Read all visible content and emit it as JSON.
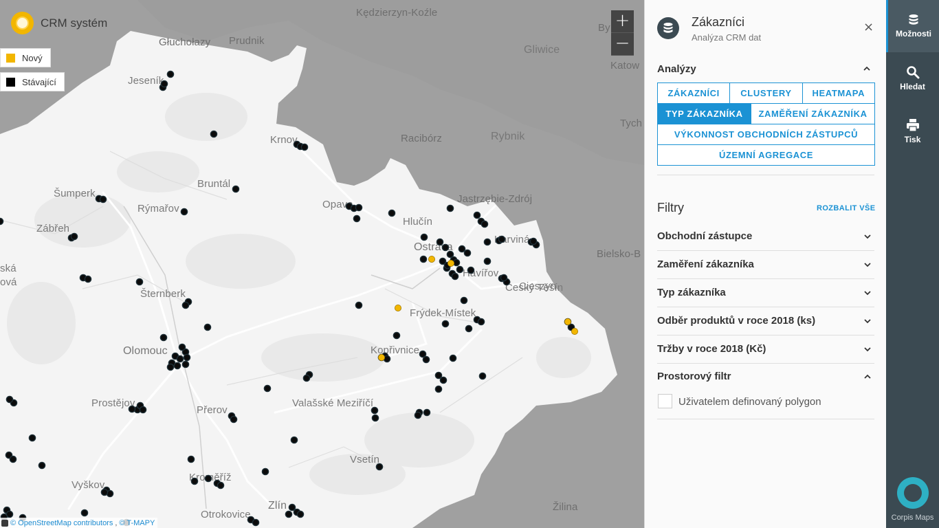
{
  "app": {
    "title": "CRM systém"
  },
  "legend": [
    {
      "label": "Nový",
      "color": "#f2b600"
    },
    {
      "label": "Stávající",
      "color": "#000000"
    }
  ],
  "zoom": {
    "in_label": "+",
    "out_label": "−"
  },
  "attribution": {
    "osm": "© OpenStreetMap contributors",
    "sep": ",",
    "tmapy": "© T-MAPY"
  },
  "map": {
    "places": [
      {
        "name": "Kędzierzyn-Koźle",
        "outside": true
      },
      {
        "name": "Gliwice",
        "outside": true
      },
      {
        "name": "Katow",
        "outside": true
      },
      {
        "name": "By",
        "outside": true
      },
      {
        "name": "Racibórz",
        "outside": true
      },
      {
        "name": "Rybnik",
        "outside": true
      },
      {
        "name": "Tych",
        "outside": true
      },
      {
        "name": "Jastrzębie-Zdrój",
        "outside": true
      },
      {
        "name": "Bielsko-B",
        "outside": true
      },
      {
        "name": "Głuchołazy",
        "outside": true
      },
      {
        "name": "Prudnik",
        "outside": true
      },
      {
        "name": "Jeseník",
        "outside": false
      },
      {
        "name": "Krnov",
        "outside": false
      },
      {
        "name": "Bruntál",
        "outside": false
      },
      {
        "name": "Opava",
        "outside": false
      },
      {
        "name": "Hlučín",
        "outside": false
      },
      {
        "name": "Ostrava",
        "outside": false
      },
      {
        "name": "Karviná",
        "outside": false
      },
      {
        "name": "Havířov",
        "outside": false
      },
      {
        "name": "Český Těšín",
        "outside": false
      },
      {
        "name": "Cieszyn",
        "outside": false
      },
      {
        "name": "Šumperk",
        "outside": false
      },
      {
        "name": "Rýmařov",
        "outside": false
      },
      {
        "name": "Zábřeh",
        "outside": false
      },
      {
        "name": "Šternberk",
        "outside": false
      },
      {
        "name": "Frýdek-Místek",
        "outside": false
      },
      {
        "name": "Olomouc",
        "outside": false
      },
      {
        "name": "Kopřivnice",
        "outside": false
      },
      {
        "name": "Prostějov",
        "outside": false
      },
      {
        "name": "Přerov",
        "outside": false
      },
      {
        "name": "Valašské Meziříčí",
        "outside": false
      },
      {
        "name": "Vsetín",
        "outside": false
      },
      {
        "name": "Kroměříž",
        "outside": false
      },
      {
        "name": "Vyškov",
        "outside": false
      },
      {
        "name": "Zlín",
        "outside": false
      },
      {
        "name": "Otrokovice",
        "outside": false
      },
      {
        "name": "Žilina",
        "outside": true
      },
      {
        "name": "ská",
        "outside": false
      },
      {
        "name": "ová",
        "outside": false
      }
    ]
  },
  "panel": {
    "title": "Zákazníci",
    "subtitle": "Analýza CRM dat",
    "close_label": "×",
    "analyses": {
      "title": "Analýzy",
      "buttons": [
        [
          "ZÁKAZNÍCI",
          "CLUSTERY",
          "HEATMAPA"
        ],
        [
          "TYP ZÁKAZNÍKA",
          "ZAMĚŘENÍ ZÁKAZNÍKA"
        ],
        [
          "VÝKONNOST OBCHODNÍCH ZÁSTUPCŮ"
        ],
        [
          "ÚZEMNÍ AGREGACE"
        ]
      ],
      "active": "TYP ZÁKAZNÍKA"
    },
    "filters": {
      "title": "Filtry",
      "expand_all": "ROZBALIT VŠE",
      "items": [
        "Obchodní zástupce",
        "Zaměření zákazníka",
        "Typ zákazníka",
        "Odběr produktů v roce 2018 (ks)",
        "Tržby v roce 2018 (Kč)",
        "Prostorový filtr"
      ],
      "polygon_label": "Uživatelem definovaný polygon"
    }
  },
  "sidebar": {
    "items": [
      {
        "label": "Možnosti",
        "icon": "database-icon"
      },
      {
        "label": "Hledat",
        "icon": "search-icon"
      },
      {
        "label": "Tisk",
        "icon": "printer-icon"
      }
    ],
    "brand": "Corpis Maps"
  },
  "colors": {
    "accent": "#1b92d4",
    "sidebar": "#3b4a52",
    "new_customer": "#f2b600",
    "existing_customer": "#000000"
  }
}
